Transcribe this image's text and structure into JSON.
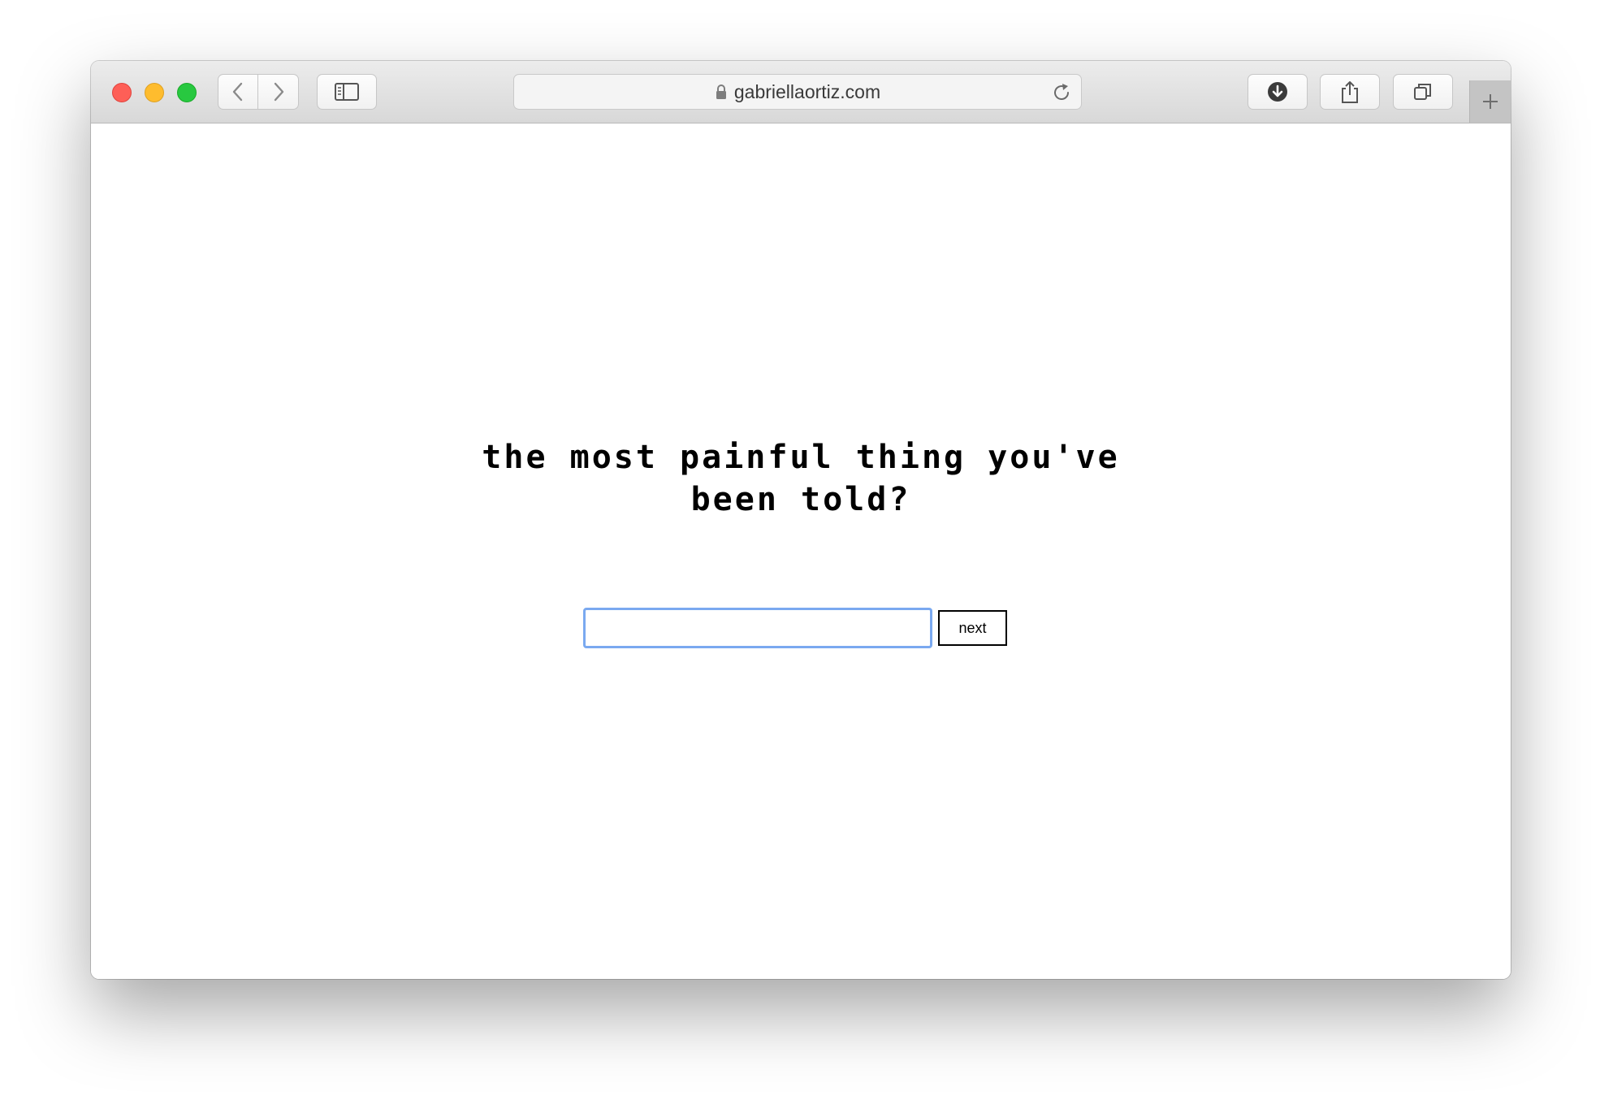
{
  "browser": {
    "url": "gabriellaortiz.com",
    "icons": {
      "back": "chevron-left-icon",
      "forward": "chevron-right-icon",
      "sidebar": "sidebar-icon",
      "lock": "lock-icon",
      "reload": "reload-icon",
      "download": "download-icon",
      "share": "share-icon",
      "tabs": "tabs-overview-icon",
      "new_tab": "plus-icon"
    },
    "traffic_colors": {
      "close": "#fe5f57",
      "minimize": "#febc2e",
      "maximize": "#28c840"
    }
  },
  "page": {
    "question": "the most painful thing you've been told?",
    "answer_value": "",
    "next_label": "next",
    "input_focus_color": "#7aa9f0"
  }
}
